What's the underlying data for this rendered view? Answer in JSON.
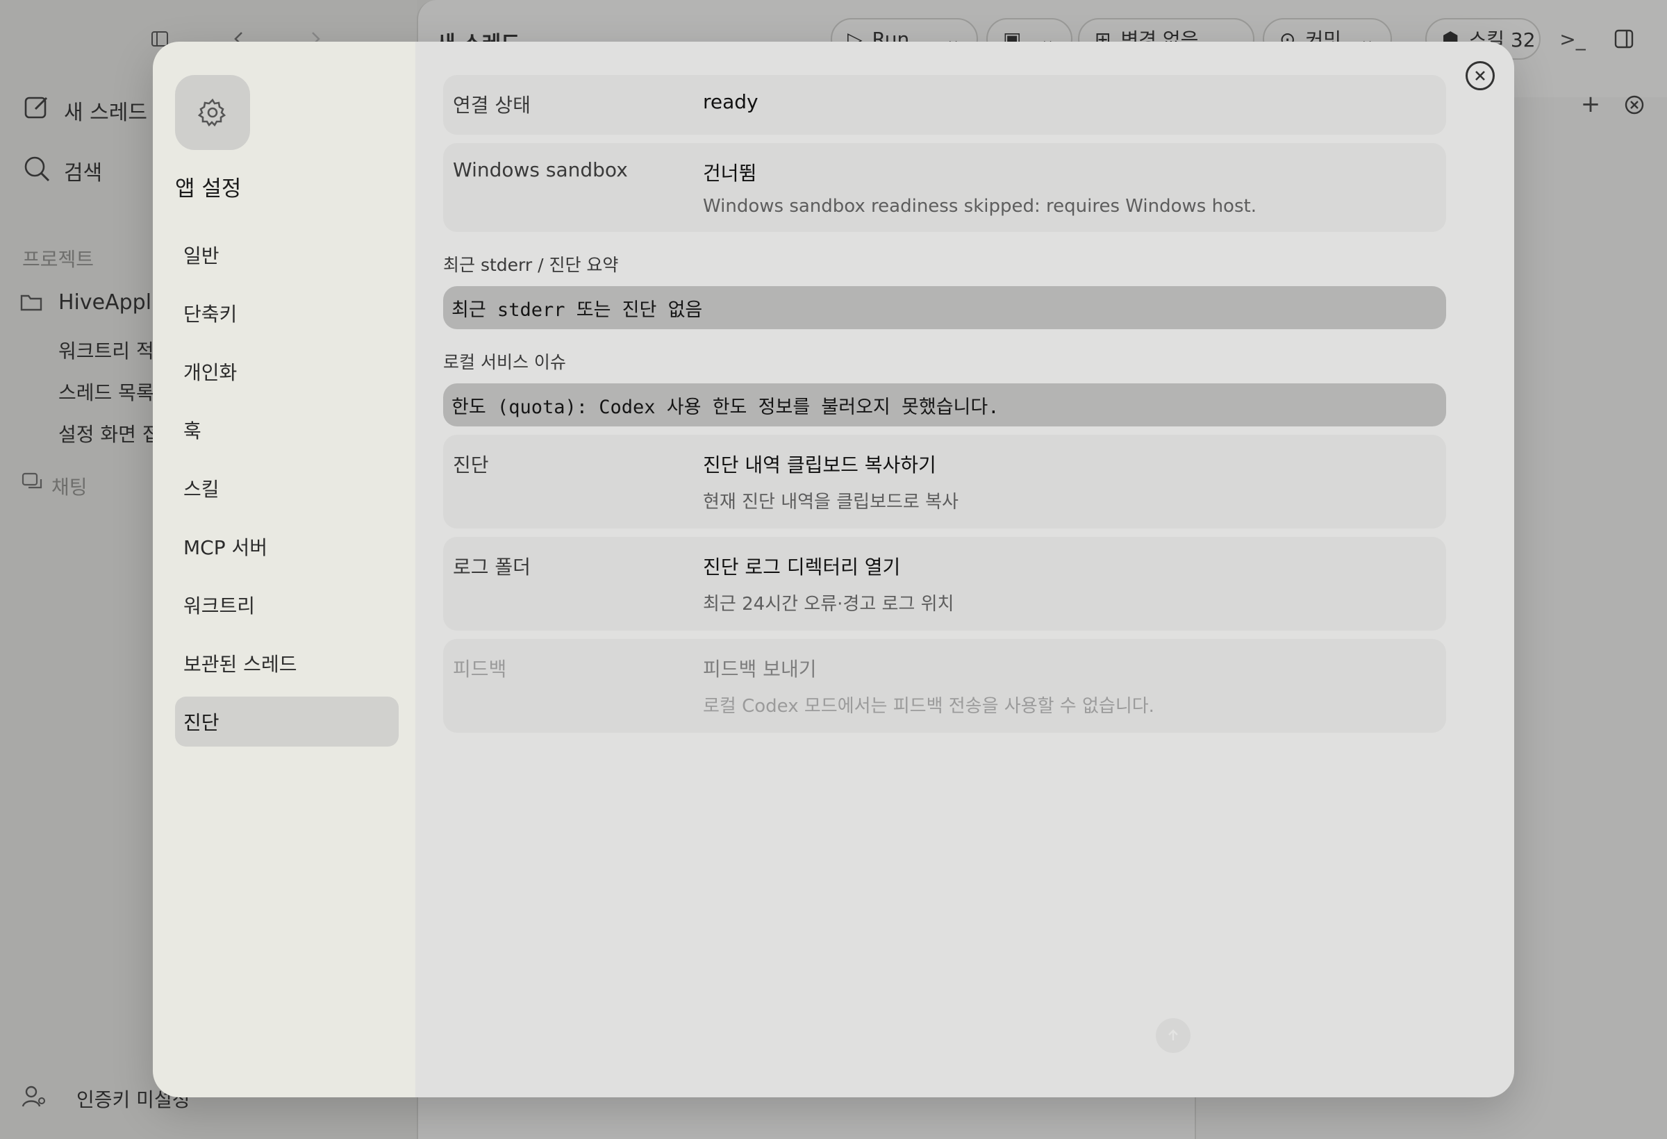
{
  "background": {
    "sidebar": {
      "new_thread": "새 스레드",
      "search": "검색",
      "projects_heading": "프로젝트",
      "project_name": "HiveAppll",
      "threads": [
        "워크트리 적용",
        "스레드 목록",
        "설정 화면 접"
      ],
      "chat": "채팅",
      "auth": "인증키 미설정"
    },
    "header": {
      "title": "새 스레드",
      "run_label": "Run",
      "changes_label": "변경 없음",
      "commit_label": "커밋",
      "skills_label": "스킬 32"
    }
  },
  "modal": {
    "nav": {
      "title": "앱 설정",
      "items": [
        {
          "label": "일반",
          "active": false
        },
        {
          "label": "단축키",
          "active": false
        },
        {
          "label": "개인화",
          "active": false
        },
        {
          "label": "훅",
          "active": false
        },
        {
          "label": "스킬",
          "active": false
        },
        {
          "label": "MCP 서버",
          "active": false
        },
        {
          "label": "워크트리",
          "active": false
        },
        {
          "label": "보관된 스레드",
          "active": false
        },
        {
          "label": "진단",
          "active": true
        }
      ]
    },
    "rows": {
      "connection": {
        "key": "연결 상태",
        "value": "ready"
      },
      "sandbox": {
        "key": "Windows sandbox",
        "value": "건너뜀",
        "detail": "Windows sandbox readiness skipped: requires Windows host."
      }
    },
    "stderr": {
      "label": "최근 stderr / 진단 요약",
      "text": "최근 stderr 또는 진단 없음"
    },
    "local_issues": {
      "label": "로컬 서비스 이슈",
      "text": "한도 (quota): Codex 사용 한도 정보를 불러오지 못했습니다."
    },
    "actions": {
      "diagnostics": {
        "key": "진단",
        "action": "진단 내역 클립보드 복사하기",
        "detail": "현재 진단 내역을 클립보드로 복사"
      },
      "log_folder": {
        "key": "로그 폴더",
        "action": "진단 로그 디렉터리 열기",
        "detail": "최근 24시간 오류·경고 로그 위치"
      },
      "feedback": {
        "key": "피드백",
        "action": "피드백 보내기",
        "detail": "로컬 Codex 모드에서는 피드백 전송을 사용할 수 없습니다."
      }
    }
  }
}
